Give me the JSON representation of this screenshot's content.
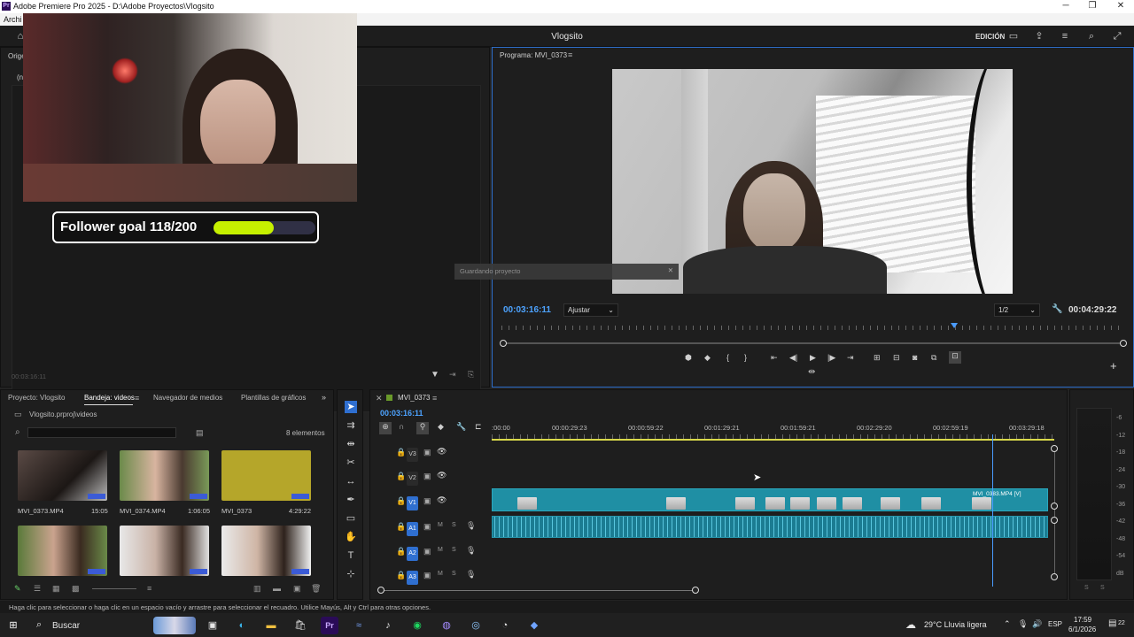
{
  "window": {
    "title": "Adobe Premiere Pro 2025 - D:\\Adobe Proyectos\\Vlogsito",
    "app_icon": "Pr",
    "menu_first": "Archi"
  },
  "header": {
    "project": "Vlogsito",
    "workspace": "EDICIÓN"
  },
  "source": {
    "tab_label": "Origen",
    "tab_sub": "(n",
    "timecode": "00:03:16:11"
  },
  "program": {
    "title": "Programa: MVI_0373",
    "timecode": "00:03:16:11",
    "fit": "Ajustar",
    "resolution": "1/2",
    "duration": "00:04:29:22",
    "playhead_fraction": 0.728
  },
  "toast": {
    "text": "Guardando proyecto"
  },
  "overlay": {
    "goal_text": "Follower goal 118/200",
    "goal_current": 118,
    "goal_total": 200,
    "bar_color": "#c6f000"
  },
  "project_panel": {
    "tabs": [
      "Proyecto: Vlogsito",
      "Bandeja: videos",
      "Navegador de medios",
      "Plantillas de gráficos"
    ],
    "active_tab": 1,
    "path": "Vlogsito.prproj\\videos",
    "count": "8 elementos",
    "items": [
      {
        "name": "MVI_0373.MP4",
        "duration": "15:05"
      },
      {
        "name": "MVI_0374.MP4",
        "duration": "1:06:05"
      },
      {
        "name": "MVI_0373",
        "duration": "4:29:22"
      },
      {
        "name": "",
        "duration": ""
      },
      {
        "name": "",
        "duration": ""
      },
      {
        "name": "",
        "duration": ""
      }
    ]
  },
  "timeline": {
    "sequence": "MVI_0373",
    "timecode": "00:03:16:11",
    "ruler": [
      ":00:00",
      "00:00:29:23",
      "00:00:59:22",
      "00:01:29:21",
      "00:01:59:21",
      "00:02:29:20",
      "00:02:59:19",
      "00:03:29:18"
    ],
    "tracks": [
      "V3",
      "V2",
      "V1",
      "A1",
      "A2",
      "A3"
    ],
    "clip_label": "MVI_0383.MP4 [V]",
    "mute": "M",
    "solo": "S",
    "playhead_fraction": 0.89
  },
  "meter": {
    "scale": [
      "-6",
      "-12",
      "-18",
      "-24",
      "-30",
      "-36",
      "-42",
      "-48",
      "-54",
      "dB"
    ],
    "bottom": [
      "S",
      "S"
    ]
  },
  "status": {
    "text": "Haga clic para seleccionar o haga clic en un espacio vacío y arrastre para seleccionar el recuadro. Utilice Mayús, Alt y Ctrl para otras opciones."
  },
  "taskbar": {
    "search": "Buscar",
    "weather": "29°C  Lluvia ligera",
    "lang": "ESP",
    "time": "17:59",
    "date": "6/1/2026",
    "notifications": "22"
  }
}
